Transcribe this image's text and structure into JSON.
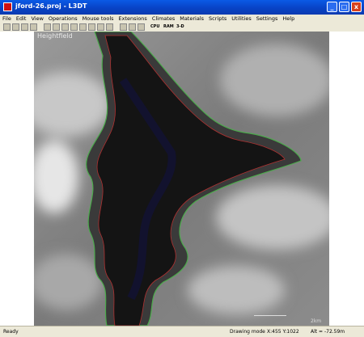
{
  "window": {
    "title": "jford-26.proj - L3DT",
    "min": "_",
    "max": "□",
    "close": "x"
  },
  "menu": [
    "File",
    "Edit",
    "View",
    "Operations",
    "Mouse tools",
    "Extensions",
    "Climates",
    "Materials",
    "Scripts",
    "Utilities",
    "Settings",
    "Help"
  ],
  "toolbar": {
    "cpu": "CPU",
    "ram": "RAM",
    "mode3d": "3-D"
  },
  "map": {
    "layer_label": "Heightfield",
    "scale_label": "2km"
  },
  "status": {
    "left": "Ready",
    "mode": "Drawing mode",
    "coords": "X:455 Y:1022",
    "alt": "Alt = -72.59m"
  }
}
